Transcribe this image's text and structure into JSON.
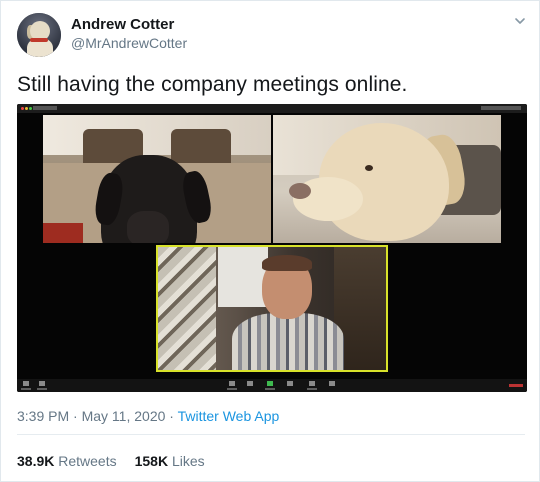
{
  "author": {
    "name": "Andrew Cotter",
    "handle": "@MrAndrewCotter"
  },
  "tweet": {
    "text": "Still having the company meetings online."
  },
  "meta": {
    "time": "3:39 PM",
    "date": "May 11, 2020",
    "separator": " · ",
    "source": "Twitter Web App"
  },
  "stats": {
    "retweets_count": "38.9K",
    "retweets_label": "Retweets",
    "likes_count": "158K",
    "likes_label": "Likes"
  },
  "icons": {
    "menu": "chevron-down-icon",
    "avatar": "dog-avatar"
  },
  "colors": {
    "text": "#14171a",
    "secondary": "#657786",
    "link": "#1b95e0",
    "active_speaker_border": "#d8e22a"
  }
}
